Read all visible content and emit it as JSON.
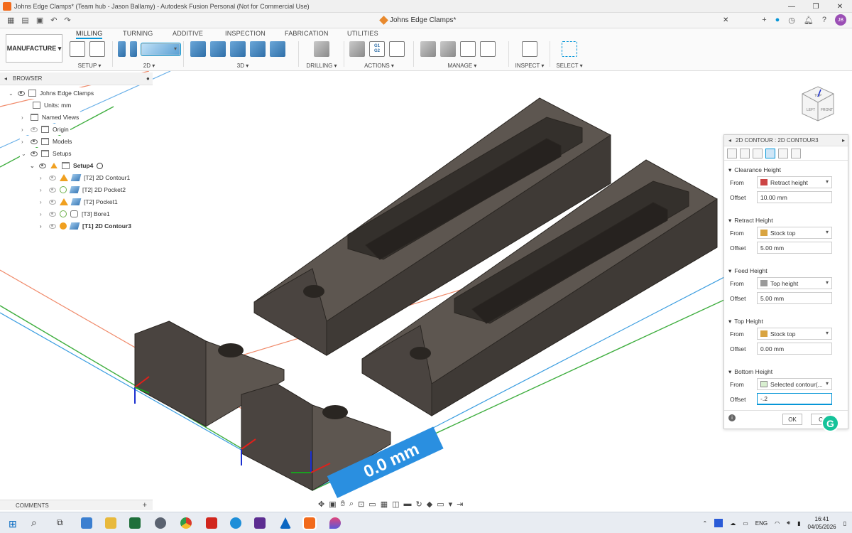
{
  "window": {
    "title": "Johns Edge Clamps* (Team hub - Jason Ballamy) - Autodesk Fusion Personal (Not for Commercial Use)",
    "controls": [
      "—",
      "❐",
      "✕"
    ]
  },
  "doc_tab": {
    "title": "Johns Edge Clamps*",
    "close": "✕"
  },
  "user_initials": "JB",
  "workspace": "MANUFACTURE",
  "ribbon_tabs": [
    "MILLING",
    "TURNING",
    "ADDITIVE",
    "INSPECTION",
    "FABRICATION",
    "UTILITIES"
  ],
  "ribbon_groups": {
    "setup": "SETUP ▾",
    "twod": "2D ▾",
    "threed": "3D ▾",
    "drilling": "DRILLING ▾",
    "actions": "ACTIONS ▾",
    "manage": "MANAGE ▾",
    "inspect": "INSPECT ▾",
    "select": "SELECT ▾"
  },
  "actions_icons": [
    "G1\nG2"
  ],
  "browser": {
    "title": "BROWSER",
    "root": "Johns Edge Clamps",
    "units": "Units: mm",
    "named_views": "Named Views",
    "origin": "Origin",
    "models": "Models",
    "setups": "Setups",
    "setup4": "Setup4",
    "ops": [
      {
        "label": "[T2] 2D Contour1",
        "status": "warning"
      },
      {
        "label": "[T2] 2D Pocket2",
        "status": "ok"
      },
      {
        "label": "[T2] Pocket1",
        "status": "warning"
      },
      {
        "label": "[T3] Bore1",
        "status": "ok"
      },
      {
        "label": "[T1] 2D Contour3",
        "status": "computing"
      }
    ]
  },
  "viewcube": {
    "left": "LEFT",
    "front": "FRONT",
    "top": "TOP"
  },
  "dimension_label": "0.0 mm",
  "panel": {
    "title": "2D CONTOUR : 2D CONTOUR3",
    "sections": [
      {
        "title": "Clearance Height",
        "from": "Retract height",
        "offset": "10.00 mm"
      },
      {
        "title": "Retract Height",
        "from": "Stock top",
        "offset": "5.00 mm"
      },
      {
        "title": "Feed Height",
        "from": "Top height",
        "offset": "5.00 mm"
      },
      {
        "title": "Top Height",
        "from": "Stock top",
        "offset": "0.00 mm"
      },
      {
        "title": "Bottom Height",
        "from": "Selected contour(...",
        "offset": "-.2"
      }
    ],
    "from_label": "From",
    "offset_label": "Offset",
    "ok": "OK",
    "cancel": "C"
  },
  "comments": {
    "label": "COMMENTS",
    "add": "+"
  },
  "taskbar": {
    "lang": "ENG",
    "time": "16:41",
    "date": "04/05/2026"
  }
}
